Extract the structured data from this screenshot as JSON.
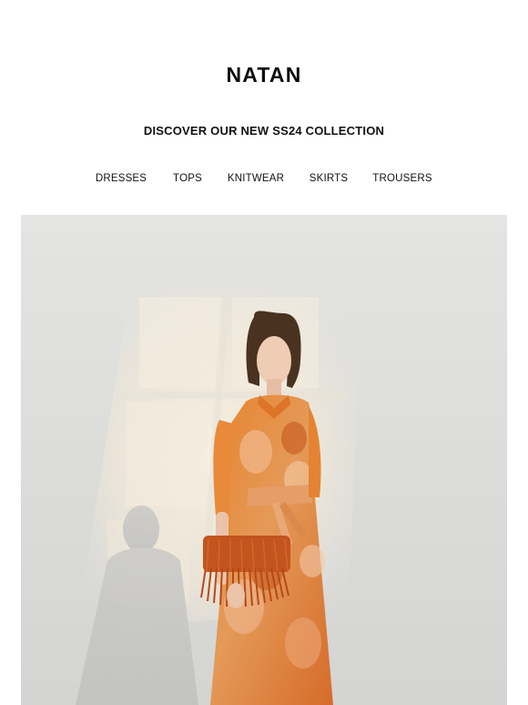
{
  "brand": {
    "logo_text": "NATAN"
  },
  "headline": "DISCOVER OUR NEW SS24 COLLECTION",
  "nav": {
    "items": [
      {
        "label": "DRESSES"
      },
      {
        "label": "TOPS"
      },
      {
        "label": "KNITWEAR"
      },
      {
        "label": "SKIRTS"
      },
      {
        "label": "TROUSERS"
      }
    ]
  },
  "hero": {
    "image": "model-in-orange-printed-dress-with-fringe-bag",
    "colors": {
      "background": "#dddddb",
      "dress": "#e07a2c",
      "bag": "#c2541e",
      "light": "#f6ecd9"
    }
  }
}
